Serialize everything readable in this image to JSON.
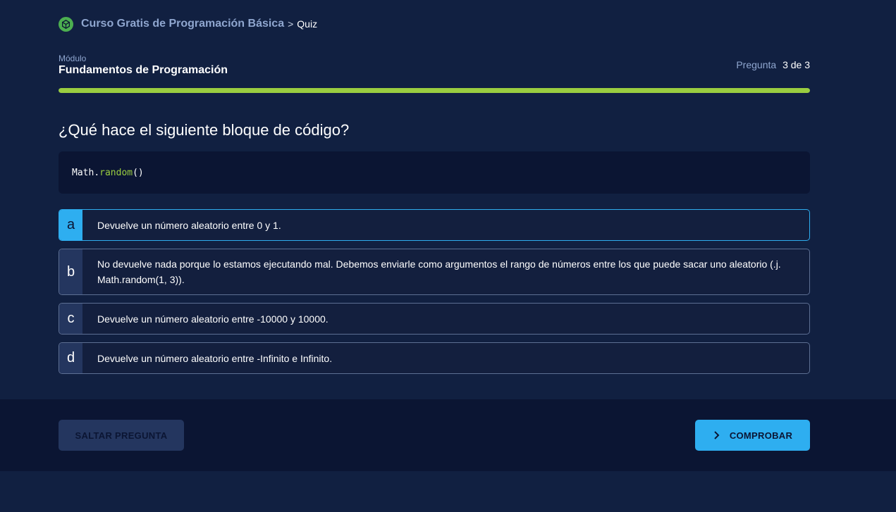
{
  "breadcrumb": {
    "course": "Curso Gratis de Programación Básica",
    "separator": ">",
    "current": "Quiz"
  },
  "module": {
    "label": "Módulo",
    "name": "Fundamentos de Programación"
  },
  "counter": {
    "label": "Pregunta",
    "value": "3 de 3"
  },
  "progress": {
    "fraction": 1.0
  },
  "question": {
    "title": "¿Qué hace el siguiente bloque de código?",
    "code": {
      "object": "Math",
      "dot": ".",
      "method": "random",
      "parens": "()"
    }
  },
  "options": [
    {
      "letter": "a",
      "text": "Devuelve un número aleatorio entre 0 y 1.",
      "selected": true
    },
    {
      "letter": "b",
      "text": "No devuelve nada porque lo estamos ejecutando mal. Debemos enviarle como argumentos el rango de números entre los que puede sacar uno aleatorio (.j. Math.random(1, 3)).",
      "selected": false
    },
    {
      "letter": "c",
      "text": "Devuelve un número aleatorio entre -10000 y 10000.",
      "selected": false
    },
    {
      "letter": "d",
      "text": "Devuelve un número aleatorio entre -Infinito e Infinito.",
      "selected": false
    }
  ],
  "footer": {
    "skip_label": "SALTAR PREGUNTA",
    "check_label": "COMPROBAR"
  },
  "colors": {
    "background": "#112041",
    "footer": "#0b1533",
    "accent": "#2eaef0",
    "progress": "#9acd40",
    "muted_text": "#8fa6cf"
  },
  "icons": {
    "logo": "cube-logo-icon",
    "check_button": "chevron-right-icon"
  }
}
